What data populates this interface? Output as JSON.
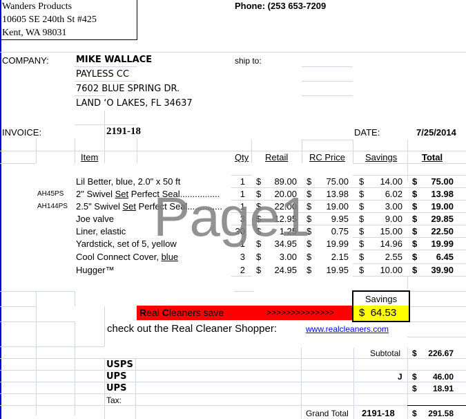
{
  "vendor": {
    "name": "Wanders Products",
    "street": "10605 SE 240th St #425",
    "city": "Kent, WA 98031",
    "phone": "Phone: (253 653-7209"
  },
  "customer": {
    "label": "COMPANY:",
    "name": "MIKE WALLACE",
    "company": "PAYLESS CC",
    "street": "7602 BLUE SPRING DR.",
    "city": "LAND ‘O LAKES, FL 34637",
    "ship_to_label": "ship to:"
  },
  "invoice": {
    "label": "INVOICE:",
    "number": "2191-18",
    "date_label": "DATE:",
    "date": "7/25/2014"
  },
  "table": {
    "headers": {
      "item": "Item",
      "qty": "Qty",
      "retail": "Retail",
      "rc_price": "RC Price",
      "savings": "Savings",
      "total": "Total"
    },
    "currency": "$",
    "rows": [
      {
        "code": "",
        "item": "Lil Better, blue, 2.0\" x 50 ft",
        "item_underline": "",
        "item_suffix": "",
        "qty": "1",
        "retail": "89.00",
        "rc_price": "75.00",
        "savings": "14.00",
        "total": "75.00"
      },
      {
        "code": "AH45PS",
        "item": "2\" Swivel ",
        "item_underline": "Set",
        "item_suffix": " Perfect Seal................",
        "qty": "1",
        "retail": "20.00",
        "rc_price": "13.98",
        "savings": "6.02",
        "total": "13.98"
      },
      {
        "code": "AH144PS",
        "item": "2.5\" Swivel ",
        "item_underline": "Set",
        "item_suffix": "  Perfect Seal..............",
        "qty": "1",
        "retail": "22.00",
        "rc_price": "19.00",
        "savings": "3.00",
        "total": "19.00"
      },
      {
        "code": "",
        "item": "Joe valve",
        "item_underline": "",
        "item_suffix": "",
        "qty": "3",
        "retail": "12.95",
        "rc_price": "9.95",
        "savings": "9.00",
        "total": "29.85"
      },
      {
        "code": "",
        "item": "Liner, elastic",
        "item_underline": "",
        "item_suffix": "",
        "qty": "30",
        "retail": "1.25",
        "rc_price": "0.75",
        "savings": "15.00",
        "total": "22.50"
      },
      {
        "code": "",
        "item": "Yardstick, set of 5, yellow",
        "item_underline": "",
        "item_suffix": "",
        "qty": "1",
        "retail": "34.95",
        "rc_price": "19.99",
        "savings": "14.96",
        "total": "19.99"
      },
      {
        "code": "",
        "item": "Cool Connect Cover,  ",
        "item_underline": "blue",
        "item_suffix": "",
        "qty": "3",
        "retail": "3.00",
        "rc_price": "2.15",
        "savings": "2.55",
        "total": "6.45"
      },
      {
        "code": "",
        "item": "Hugger™",
        "item_underline": "",
        "item_suffix": "",
        "qty": "2",
        "retail": "24.95",
        "rc_price": "19.95",
        "savings": "10.00",
        "total": "39.90"
      }
    ]
  },
  "watermark": "Page1",
  "promo": {
    "r_letter": "R",
    "eal": "eal ",
    "c_letter": "C",
    "leaners_save": "leaners save",
    "arrows": ">>>>>>>>>>>>>>",
    "savings_label": "Savings",
    "savings_currency": "$",
    "savings_value": "64.53",
    "shopper_text": "check out the Real Cleaner Shopper:",
    "shopper_link": "www.realcleaners.com ",
    "red_color": "#ff0000",
    "yellow_color": "#ffff00"
  },
  "totals": {
    "subtotal_label": "Subtotal",
    "subtotal": "226.67",
    "shipping": [
      {
        "carrier": "USPS",
        "mark": "",
        "amount": ""
      },
      {
        "carrier": "UPS",
        "mark": "J",
        "amount": "46.00"
      },
      {
        "carrier": "UPS",
        "mark": "",
        "amount": "18.91"
      }
    ],
    "tax_label": "Tax:",
    "grand_total_label": "Grand Total",
    "grand_total_invoice": "2191-18",
    "grand_total": "291.58",
    "currency": "$"
  }
}
